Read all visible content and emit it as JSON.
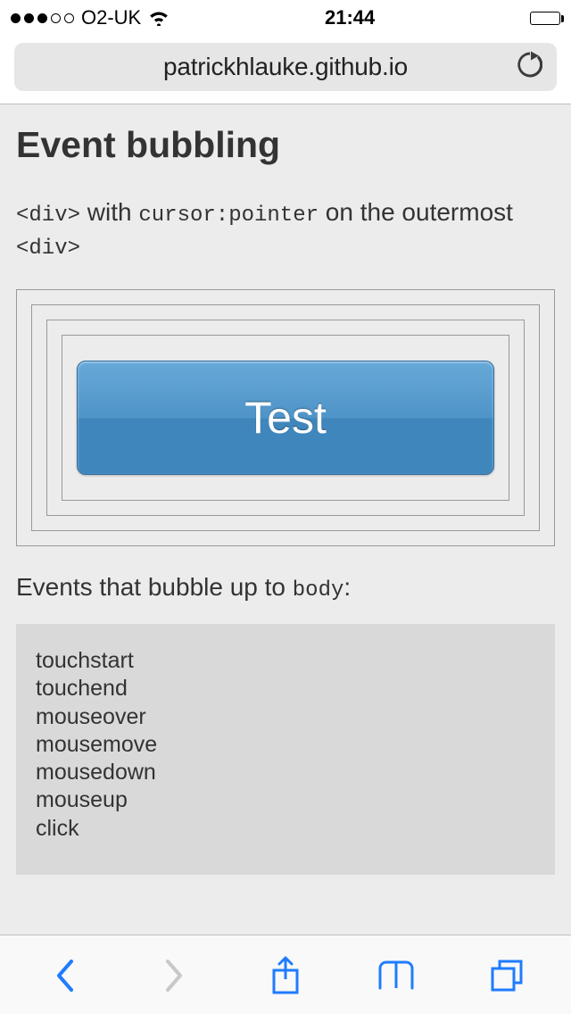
{
  "status": {
    "carrier": "O2-UK",
    "time": "21:44"
  },
  "url_bar": {
    "domain": "patrickhlauke.github.io"
  },
  "page": {
    "title": "Event bubbling",
    "subhead_pre": "<div>",
    "subhead_mid1": " with ",
    "subhead_code2": "cursor:pointer",
    "subhead_mid2": " on the outermost ",
    "subhead_code3": "<div>",
    "button_label": "Test",
    "events_label_pre": "Events that bubble up to ",
    "events_label_code": "body",
    "events_label_post": ":",
    "events": [
      "touchstart",
      "touchend",
      "mouseover",
      "mousemove",
      "mousedown",
      "mouseup",
      "click"
    ]
  }
}
